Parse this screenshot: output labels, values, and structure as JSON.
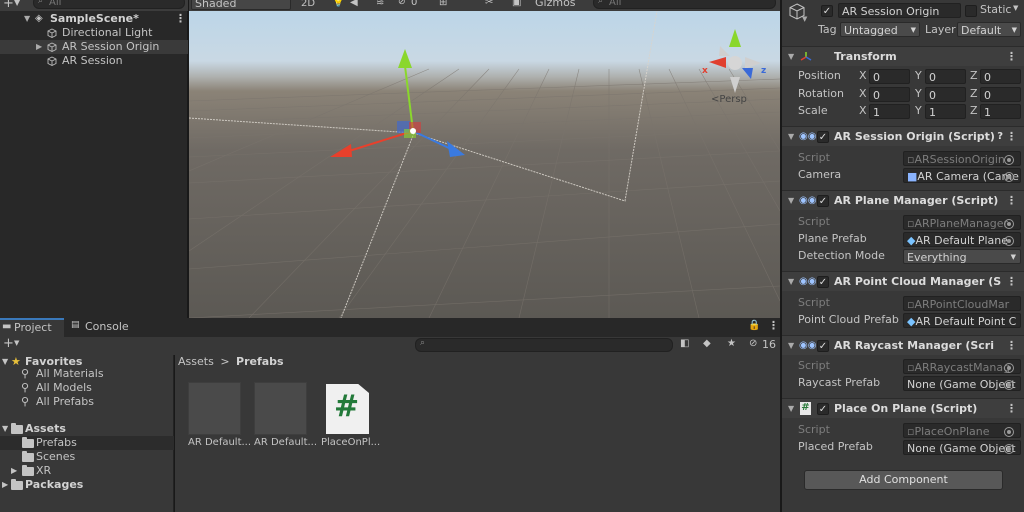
{
  "hierarchy": {
    "search_placeholder": "All",
    "scene_name": "SampleScene*",
    "items": [
      {
        "label": "Directional Light"
      },
      {
        "label": "AR Session Origin"
      },
      {
        "label": "AR Session"
      }
    ]
  },
  "scene_toolbar": {
    "shading_mode": "Shaded",
    "mode_2d": "2D",
    "hidden_count": "0",
    "gizmos_label": "Gizmos",
    "search_placeholder": "All"
  },
  "scene_view": {
    "persp_label": "Persp",
    "gizmo_x": "x",
    "gizmo_z": "z",
    "colors": {
      "x_axis": "#e8402c",
      "y_axis": "#8ad72c",
      "z_axis": "#3a7ae0"
    }
  },
  "inspector": {
    "object_name": "AR Session Origin",
    "static_label": "Static",
    "tag_label": "Tag",
    "tag_value": "Untagged",
    "layer_label": "Layer",
    "layer_value": "Default",
    "transform": {
      "title": "Transform",
      "position_label": "Position",
      "rotation_label": "Rotation",
      "scale_label": "Scale",
      "x": "X",
      "y": "Y",
      "z": "Z",
      "position": [
        "0",
        "0",
        "0"
      ],
      "rotation": [
        "0",
        "0",
        "0"
      ],
      "scale": [
        "1",
        "1",
        "1"
      ]
    },
    "components": [
      {
        "title": "AR Session Origin (Script)",
        "rows": [
          {
            "label": "Script",
            "value": "ARSessionOrigin",
            "dim": true
          },
          {
            "label": "Camera",
            "value": "AR Camera (Came",
            "dim": false
          }
        ]
      },
      {
        "title": "AR Plane Manager (Script)",
        "rows": [
          {
            "label": "Script",
            "value": "ARPlaneManager",
            "dim": true
          },
          {
            "label": "Plane Prefab",
            "value": "AR Default Plane",
            "dim": false
          },
          {
            "label": "Detection Mode",
            "value": "Everything",
            "dim": false
          }
        ]
      },
      {
        "title": "AR Point Cloud Manager (S",
        "rows": [
          {
            "label": "Script",
            "value": "ARPointCloudMar",
            "dim": true
          },
          {
            "label": "Point Cloud Prefab",
            "value": "AR Default Point C",
            "dim": false
          }
        ]
      },
      {
        "title": "AR Raycast Manager (Scri",
        "rows": [
          {
            "label": "Script",
            "value": "ARRaycastManag",
            "dim": true
          },
          {
            "label": "Raycast Prefab",
            "value": "None (Game Object",
            "dim": false
          }
        ]
      },
      {
        "title": "Place On Plane (Script)",
        "rows": [
          {
            "label": "Script",
            "value": "PlaceOnPlane",
            "dim": true
          },
          {
            "label": "Placed Prefab",
            "value": "None (Game Object",
            "dim": false
          }
        ]
      }
    ],
    "add_component_label": "Add Component"
  },
  "project": {
    "tab_project": "Project",
    "tab_console": "Console",
    "hidden_count": "16",
    "favorites_label": "Favorites",
    "favorites": [
      "All Materials",
      "All Models",
      "All Prefabs"
    ],
    "assets_label": "Assets",
    "asset_folders": [
      "Prefabs",
      "Scenes",
      "XR"
    ],
    "packages_label": "Packages",
    "breadcrumb_root": "Assets",
    "breadcrumb_sep": ">",
    "breadcrumb_current": "Prefabs",
    "assets": [
      {
        "label": "AR Default..."
      },
      {
        "label": "AR Default..."
      },
      {
        "label": "PlaceOnPl..."
      }
    ],
    "script_glyph": "#"
  }
}
